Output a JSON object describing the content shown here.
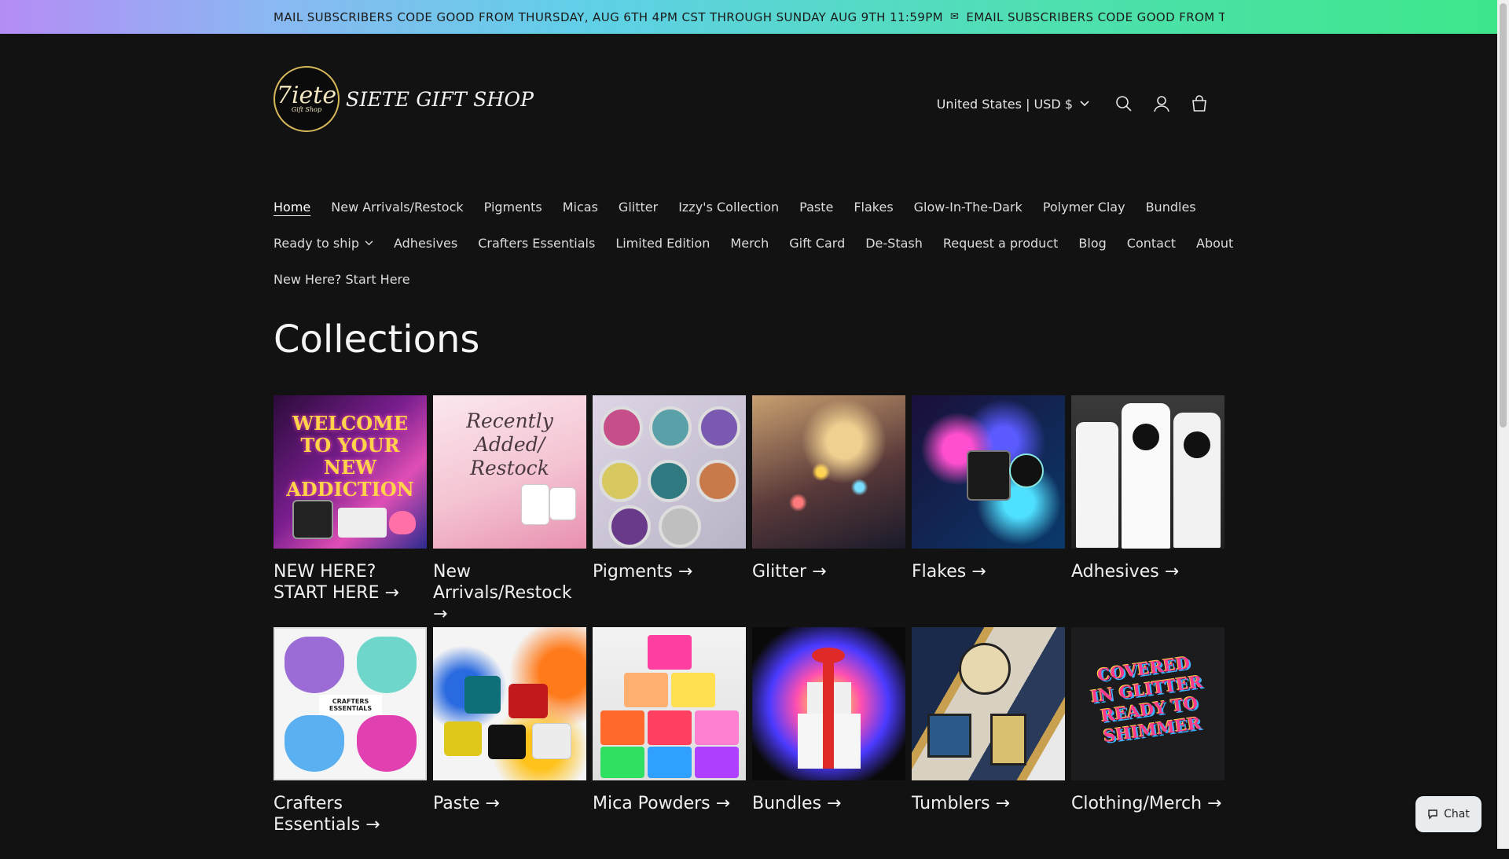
{
  "announcement": {
    "text_1": "MAIL SUBSCRIBERS CODE GOOD FROM THURSDAY, AUG 6TH 4PM CST THROUGH SUNDAY AUG 9TH 11:59PM",
    "text_2": "EMAIL SUBSCRIBERS CODE GOOD FROM THURSDAY, AU"
  },
  "header": {
    "logo_mark": "7iete",
    "logo_mark_sub": "Gift Shop",
    "store_name": "SIETE GIFT SHOP",
    "currency": "United States | USD $",
    "icons": [
      "search-icon",
      "account-icon",
      "cart-icon"
    ]
  },
  "nav": {
    "row1": [
      "Home",
      "New Arrivals/Restock",
      "Pigments",
      "Micas",
      "Glitter",
      "Izzy's Collection",
      "Paste",
      "Flakes",
      "Glow-In-The-Dark",
      "Polymer Clay",
      "Bundles"
    ],
    "row2": [
      "Ready to ship",
      "Adhesives",
      "Crafters Essentials",
      "Limited Edition",
      "Merch",
      "Gift Card",
      "De-Stash",
      "Request a product",
      "Blog",
      "Contact",
      "About"
    ],
    "row3": [
      "New Here? Start Here"
    ],
    "active": "Home"
  },
  "collections": {
    "heading": "Collections",
    "items": [
      {
        "title": "NEW HERE? START HERE →",
        "image_text": "WELCOME TO YOUR NEW ADDICTION"
      },
      {
        "title": "New Arrivals/Restock →",
        "image_text": "Recently Added/ Restock"
      },
      {
        "title": "Pigments →"
      },
      {
        "title": "Glitter →"
      },
      {
        "title": "Flakes →"
      },
      {
        "title": "Adhesives →"
      },
      {
        "title": "Crafters Essentials →",
        "image_text": "CRAFTERS ESSENTIALS"
      },
      {
        "title": "Paste →"
      },
      {
        "title": "Mica Powders →"
      },
      {
        "title": "Bundles →"
      },
      {
        "title": "Tumblers →"
      },
      {
        "title": "Clothing/Merch →",
        "image_text": "COVERED IN GLITTER READY TO SHIMMER"
      }
    ]
  },
  "chat": {
    "label": "Chat"
  },
  "colors": {
    "background": "#121212",
    "text": "#e8e8e8",
    "logo_gold": "#d6b85a"
  }
}
